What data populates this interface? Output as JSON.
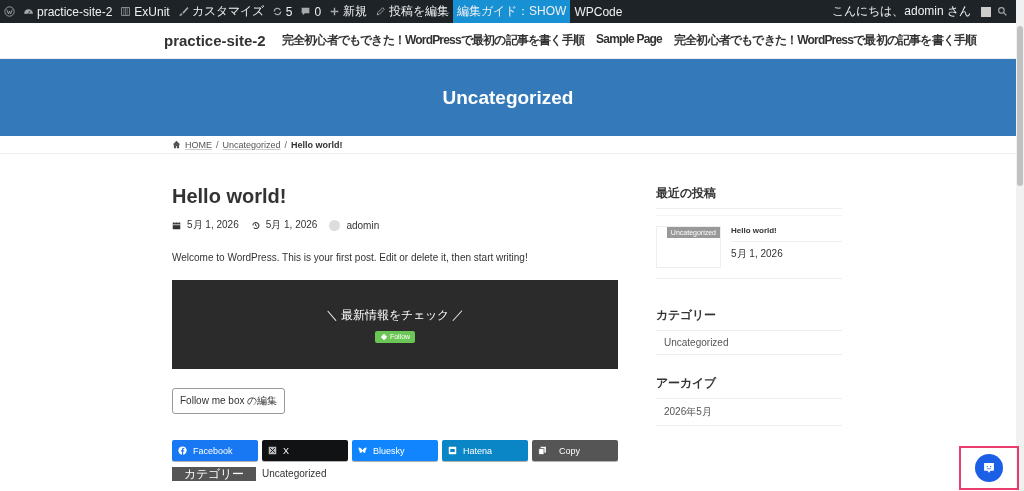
{
  "admin_bar": {
    "items": [
      {
        "kind": "wp",
        "highlighted": false
      },
      {
        "kind": "dashboard",
        "label": "practice-site-2",
        "highlighted": false
      },
      {
        "kind": "exunit",
        "label": "ExUnit",
        "highlighted": false
      },
      {
        "kind": "brush",
        "label": "カスタマイズ",
        "highlighted": false
      },
      {
        "kind": "updates",
        "label": "5",
        "highlighted": false
      },
      {
        "kind": "comments",
        "label": "0",
        "highlighted": false
      },
      {
        "kind": "plus",
        "label": "新規",
        "highlighted": false
      },
      {
        "kind": "pencil",
        "label": "投稿を編集",
        "highlighted": false
      },
      {
        "kind": "text",
        "label": "編集ガイド：SHOW",
        "highlighted": true
      },
      {
        "kind": "text",
        "label": "WPCode",
        "highlighted": false
      }
    ],
    "greeting": "こんにちは、adomin さん"
  },
  "header": {
    "site_title": "practice-site-2",
    "nav": [
      "完全初心者でもできた！WordPressで最初の記事を書く手順",
      "Sample Page",
      "完全初心者でもできた！WordPressで最初の記事を書く手順"
    ]
  },
  "page_header": {
    "title": "Uncategorized"
  },
  "breadcrumb_separator": "/",
  "breadcrumb": [
    {
      "label": "HOME",
      "current": false
    },
    {
      "label": "Uncategorized",
      "current": false
    },
    {
      "label": "Hello world!",
      "current": true
    }
  ],
  "post": {
    "title": "Hello world!",
    "published": "5月 1, 2026",
    "updated": "5月 1, 2026",
    "author": "adomin",
    "body": "Welcome to WordPress. This is your first post. Edit or delete it, then start writing!",
    "follow_box": {
      "heading": "＼ 最新情報をチェック ／",
      "button": "Follow"
    },
    "edit_button": "Follow me box の編集",
    "share": [
      {
        "kind": "facebook",
        "label": "Facebook",
        "color": "#1877f2"
      },
      {
        "kind": "x",
        "label": "X",
        "color": "#101214"
      },
      {
        "kind": "bluesky",
        "label": "Bluesky",
        "color": "#1185fe"
      },
      {
        "kind": "hatena",
        "label": "Hatena",
        "color": "#0a85c6"
      },
      {
        "kind": "copy",
        "label": "Copy",
        "color": "#555555"
      }
    ],
    "category_label": "カテゴリー",
    "category": "Uncategorized"
  },
  "sidebar": {
    "recent": {
      "heading": "最近の投稿",
      "posts": [
        {
          "badge": "Uncategorized",
          "title": "Hello world!",
          "date": "5月 1, 2026"
        }
      ]
    },
    "categories": {
      "heading": "カテゴリー",
      "items": [
        "Uncategorized"
      ]
    },
    "archives": {
      "heading": "アーカイブ",
      "items": [
        "2026年5月"
      ]
    }
  }
}
